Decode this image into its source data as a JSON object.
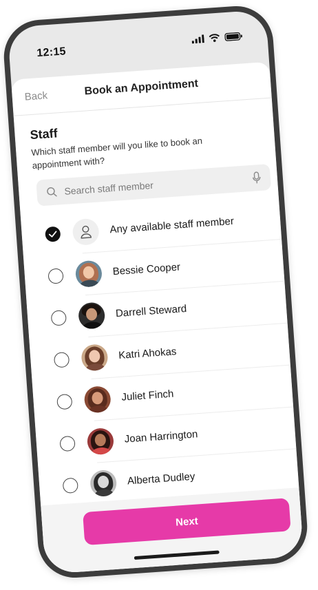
{
  "status_bar": {
    "time": "12:15"
  },
  "nav": {
    "back_label": "Back",
    "title": "Book an Appointment"
  },
  "section": {
    "title": "Staff",
    "description": "Which staff member will you like to book an appointment with?"
  },
  "search": {
    "placeholder": "Search staff member",
    "value": ""
  },
  "staff": [
    {
      "name": "Any available staff member",
      "selected": true,
      "avatar": "user-icon"
    },
    {
      "name": "Bessie Cooper",
      "selected": false,
      "avatar": "avatar-bessie-cooper"
    },
    {
      "name": "Darrell Steward",
      "selected": false,
      "avatar": "avatar-darrell-steward"
    },
    {
      "name": "Katri Ahokas",
      "selected": false,
      "avatar": "avatar-katri-ahokas"
    },
    {
      "name": "Juliet Finch",
      "selected": false,
      "avatar": "avatar-juliet-finch"
    },
    {
      "name": "Joan Harrington",
      "selected": false,
      "avatar": "avatar-joan-harrington"
    },
    {
      "name": "Alberta Dudley",
      "selected": false,
      "avatar": "avatar-alberta-dudley"
    }
  ],
  "footer": {
    "next_label": "Next"
  },
  "colors": {
    "accent": "#e63aa8",
    "frame": "#3c3c3c",
    "selected": "#111111"
  }
}
